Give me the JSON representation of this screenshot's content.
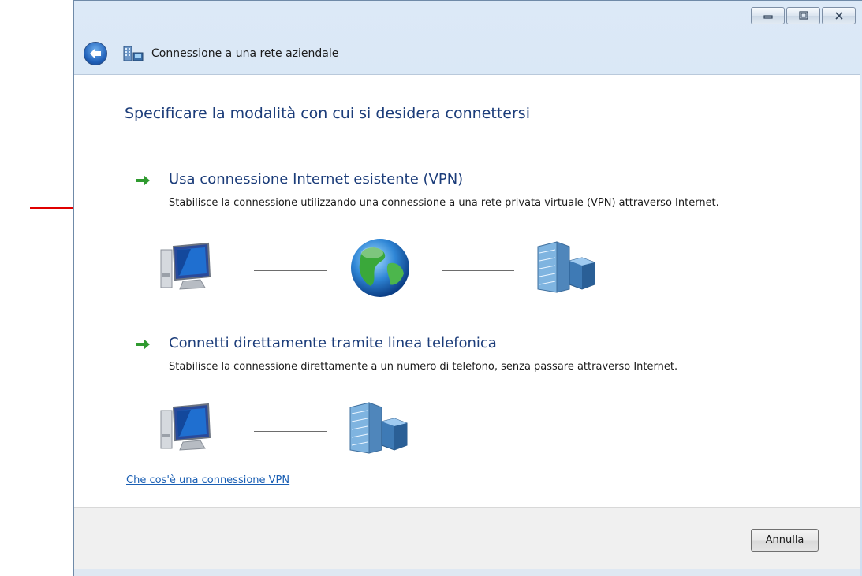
{
  "window": {
    "title": "Connessione a una rete aziendale",
    "icon": "network-connection-icon",
    "caption_buttons": [
      "minimize-icon",
      "maximize-icon",
      "close-icon"
    ]
  },
  "main": {
    "heading": "Specificare la modalità con cui si desidera connettersi",
    "options": [
      {
        "title": "Usa connessione Internet esistente (VPN)",
        "description": "Stabilisce la connessione utilizzando una connessione a una rete privata virtuale (VPN) attraverso Internet.",
        "diagram_icons": [
          "computer-icon",
          "globe-icon",
          "office-building-icon"
        ]
      },
      {
        "title": "Connetti direttamente tramite linea telefonica",
        "description": "Stabilisce la connessione direttamente a un numero di telefono, senza passare attraverso Internet.",
        "diagram_icons": [
          "computer-icon",
          "office-building-icon"
        ]
      }
    ],
    "help_link": "Che cos'è una connessione VPN"
  },
  "footer": {
    "cancel_label": "Annulla"
  },
  "colors": {
    "heading": "#1c3d7a",
    "link": "#1a5fb4",
    "option_arrow": "#2f9a2f",
    "annotation_arrow": "#e00000"
  }
}
